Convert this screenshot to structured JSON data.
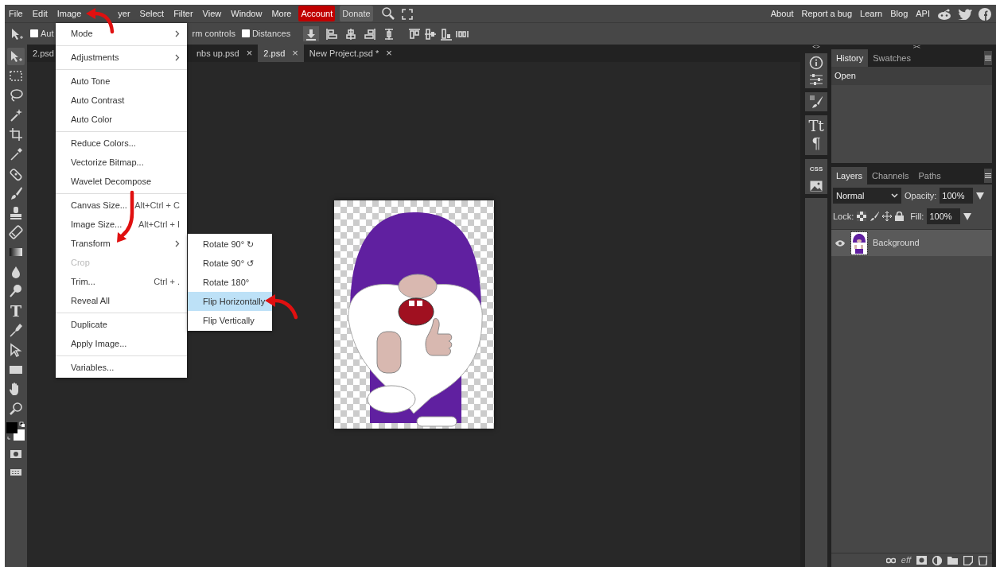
{
  "menubar": {
    "items": [
      {
        "label": "File",
        "kind": "plain"
      },
      {
        "label": "Edit",
        "kind": "plain"
      },
      {
        "label": "Image",
        "kind": "plain"
      },
      {
        "label": "yer",
        "kind": "covered"
      },
      {
        "label": "Select",
        "kind": "plain"
      },
      {
        "label": "Filter",
        "kind": "plain"
      },
      {
        "label": "View",
        "kind": "plain"
      },
      {
        "label": "Window",
        "kind": "plain"
      },
      {
        "label": "More",
        "kind": "plain"
      },
      {
        "label": "Account",
        "kind": "account"
      },
      {
        "label": "Donate",
        "kind": "donate"
      }
    ],
    "links": [
      "About",
      "Report a bug",
      "Learn",
      "Blog",
      "API"
    ]
  },
  "options_bar": {
    "items": [
      {
        "kind": "checkbox",
        "label": "Aut",
        "checked": false
      },
      {
        "kind": "text",
        "label": "rm controls"
      },
      {
        "kind": "checkbox",
        "label": "Distances",
        "checked": false
      }
    ]
  },
  "tools": {
    "type_glyph": "T"
  },
  "tabs": [
    {
      "label": "2.psd",
      "selected": false
    },
    {
      "label": "nbs up.psd",
      "close": "×",
      "selected": false
    },
    {
      "label": "2.psd",
      "close": "×",
      "selected": true
    },
    {
      "label": "New Project.psd *",
      "close": "×",
      "selected": false
    }
  ],
  "image_menu": {
    "items": [
      {
        "kind": "submenu",
        "label": "Mode",
        "disabled": false
      },
      {
        "kind": "separator"
      },
      {
        "kind": "submenu",
        "label": "Adjustments",
        "disabled": false
      },
      {
        "kind": "separator"
      },
      {
        "kind": "item",
        "label": "Auto Tone",
        "disabled": false
      },
      {
        "kind": "item",
        "label": "Auto Contrast",
        "disabled": false
      },
      {
        "kind": "item",
        "label": "Auto Color",
        "disabled": false
      },
      {
        "kind": "separator"
      },
      {
        "kind": "item",
        "label": "Reduce Colors...",
        "disabled": false
      },
      {
        "kind": "item",
        "label": "Vectorize Bitmap...",
        "disabled": false
      },
      {
        "kind": "item",
        "label": "Wavelet Decompose",
        "disabled": false
      },
      {
        "kind": "separator"
      },
      {
        "kind": "item",
        "label": "Canvas Size...",
        "shortcut": "Alt+Ctrl + C",
        "disabled": false
      },
      {
        "kind": "item",
        "label": "Image Size...",
        "shortcut": "Alt+Ctrl + I",
        "disabled": false
      },
      {
        "kind": "submenu",
        "label": "Transform",
        "disabled": false
      },
      {
        "kind": "item",
        "label": "Crop",
        "disabled": true
      },
      {
        "kind": "item",
        "label": "Trim...",
        "shortcut": "Ctrl + .",
        "disabled": false
      },
      {
        "kind": "item",
        "label": "Reveal All",
        "disabled": false
      },
      {
        "kind": "separator"
      },
      {
        "kind": "item",
        "label": "Duplicate",
        "disabled": false
      },
      {
        "kind": "item",
        "label": "Apply Image...",
        "disabled": false
      },
      {
        "kind": "separator"
      },
      {
        "kind": "item",
        "label": "Variables...",
        "disabled": false
      }
    ]
  },
  "transform_menu": {
    "items": [
      {
        "label": "Rotate 90° ↻",
        "selected": false
      },
      {
        "label": "Rotate 90° ↺",
        "selected": false
      },
      {
        "label": "Rotate 180°",
        "selected": false
      },
      {
        "label": "Flip Horizontally",
        "selected": true
      },
      {
        "label": "Flip Vertically",
        "selected": false
      }
    ]
  },
  "side_strip": {
    "marks": [
      "<>",
      "><"
    ],
    "character": "Tt",
    "paragraph": "¶",
    "css": "CSS"
  },
  "history": {
    "tabs": [
      {
        "label": "History",
        "selected": true
      },
      {
        "label": "Swatches",
        "selected": false
      }
    ],
    "entries": [
      "Open"
    ]
  },
  "layers": {
    "tabs": [
      {
        "label": "Layers",
        "selected": true
      },
      {
        "label": "Channels",
        "selected": false
      },
      {
        "label": "Paths",
        "selected": false
      }
    ],
    "blend_mode": "Normal",
    "opacity_label": "Opacity:",
    "opacity": "100%",
    "lock_label": "Lock:",
    "fill_label": "Fill:",
    "fill": "100%",
    "items": [
      {
        "name": "Background",
        "selected": true,
        "visible": true
      }
    ],
    "effects_label": "eff"
  }
}
